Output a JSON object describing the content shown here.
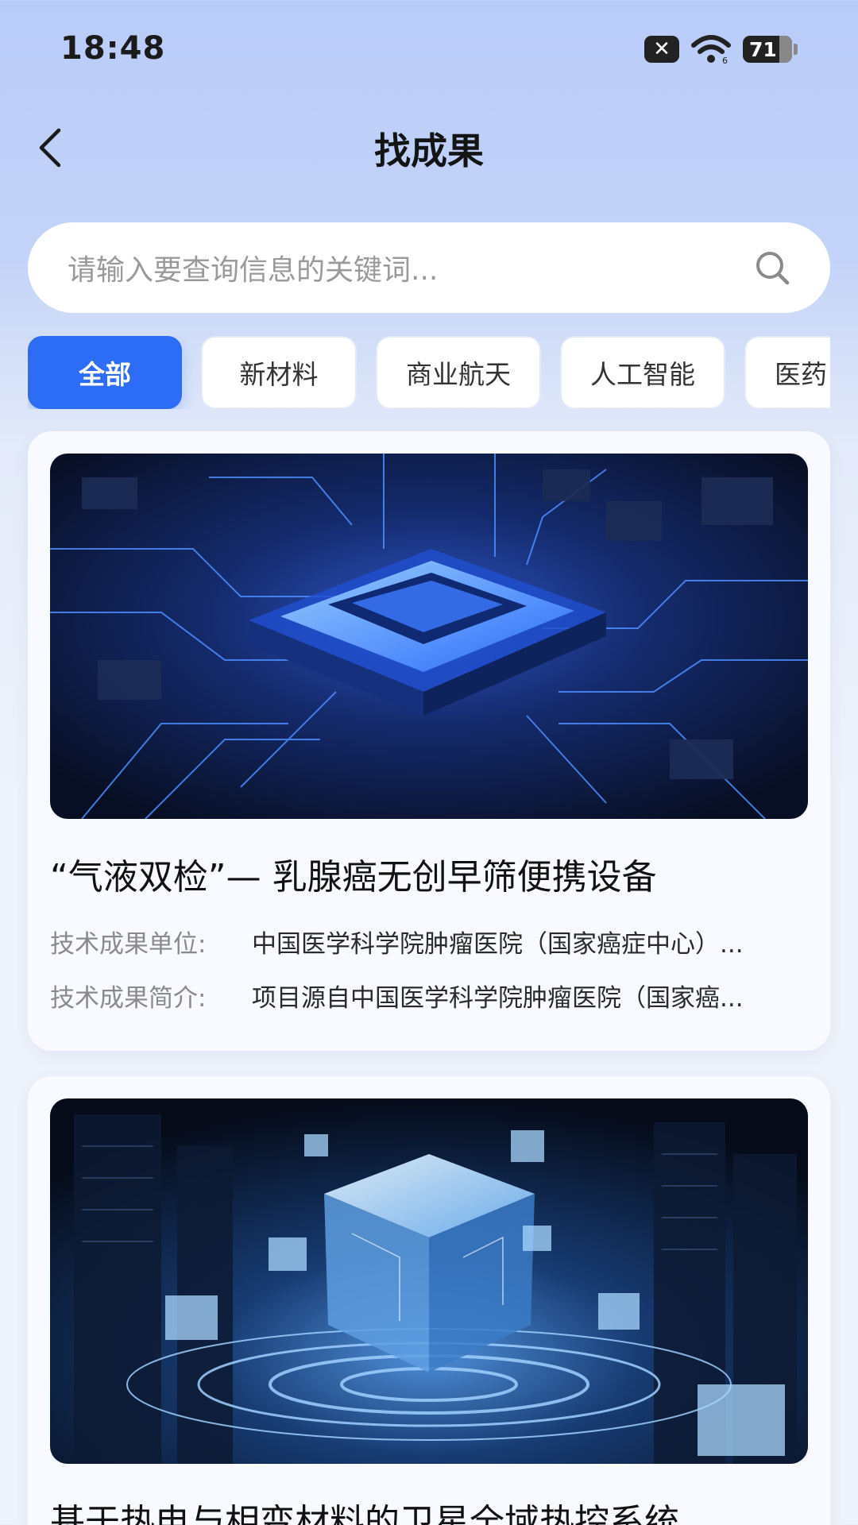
{
  "status_bar": {
    "time": "18:48",
    "battery": "71"
  },
  "header": {
    "title": "找成果"
  },
  "search": {
    "placeholder": "请输入要查询信息的关键词..."
  },
  "tabs": [
    {
      "label": "全部",
      "active": true
    },
    {
      "label": "新材料",
      "active": false
    },
    {
      "label": "商业航天",
      "active": false
    },
    {
      "label": "人工智能",
      "active": false
    },
    {
      "label": "医药",
      "active": false
    }
  ],
  "cards": [
    {
      "image_icon": "circuit-chip-image",
      "title": "“气液双检”— 乳腺癌无创早筛便携设备",
      "unit_label": "技术成果单位:",
      "unit_value": "中国医学科学院肿瘤医院（国家癌症中心）...",
      "intro_label": "技术成果简介:",
      "intro_value": "项目源自中国医学科学院肿瘤医院（国家癌..."
    },
    {
      "image_icon": "data-cube-image",
      "title": "基于热电与相变材料的卫星全域热控系统"
    }
  ],
  "colors": {
    "accent": "#2d6df5",
    "background_top": "#b9ccf8",
    "background_bottom": "#eef2fa"
  }
}
